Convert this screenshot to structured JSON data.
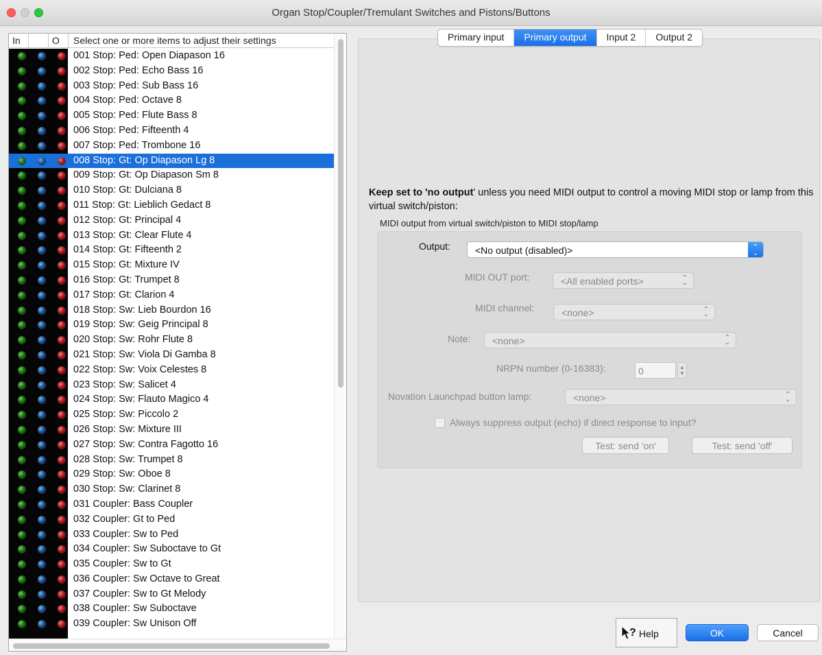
{
  "window": {
    "title": "Organ Stop/Coupler/Tremulant Switches and Pistons/Buttons"
  },
  "list": {
    "header": {
      "in": "In",
      "o": "O",
      "instruction": "Select one or more items to adjust their settings"
    },
    "selected_index": 7,
    "items": [
      "001 Stop: Ped: Open Diapason 16",
      "002 Stop: Ped: Echo Bass 16",
      "003 Stop: Ped: Sub Bass 16",
      "004 Stop: Ped: Octave 8",
      "005 Stop: Ped: Flute Bass 8",
      "006 Stop: Ped: Fifteenth 4",
      "007 Stop: Ped: Trombone 16",
      "008 Stop: Gt: Op Diapason Lg 8",
      "009 Stop: Gt: Op Diapason Sm 8",
      "010 Stop: Gt: Dulciana 8",
      "011 Stop: Gt: Lieblich Gedact 8",
      "012 Stop: Gt: Principal 4",
      "013 Stop: Gt: Clear Flute 4",
      "014 Stop: Gt: Fifteenth 2",
      "015 Stop: Gt: Mixture IV",
      "016 Stop: Gt: Trumpet 8",
      "017 Stop: Gt: Clarion 4",
      "018 Stop: Sw: Lieb Bourdon 16",
      "019 Stop: Sw: Geig Principal 8",
      "020 Stop: Sw: Rohr Flute 8",
      "021 Stop: Sw: Viola Di Gamba 8",
      "022 Stop: Sw: Voix Celestes 8",
      "023 Stop: Sw: Salicet 4",
      "024 Stop: Sw: Flauto Magico 4",
      "025 Stop: Sw: Piccolo 2",
      "026 Stop: Sw: Mixture III",
      "027 Stop: Sw: Contra Fagotto 16",
      "028 Stop: Sw: Trumpet 8",
      "029 Stop: Sw: Oboe 8",
      "030 Stop: Sw: Clarinet 8",
      "031 Coupler: Bass Coupler",
      "032 Coupler: Gt to Ped",
      "033 Coupler: Sw to Ped",
      "034 Coupler: Sw Suboctave to Gt",
      "035 Coupler: Sw to Gt",
      "036 Coupler: Sw Octave to Great",
      "037 Coupler: Sw to Gt Melody",
      "038 Coupler: Sw Suboctave",
      "039 Coupler: Sw Unison Off"
    ]
  },
  "tabs": [
    {
      "label": "Primary input",
      "active": false
    },
    {
      "label": "Primary output",
      "active": true
    },
    {
      "label": "Input 2",
      "active": false
    },
    {
      "label": "Output 2",
      "active": false
    }
  ],
  "output_tab": {
    "info_bold_prefix": "Keep set to '",
    "info_bold_value": "no output",
    "info_rest": "' unless you need MIDI output to control a moving MIDI stop or lamp from this virtual switch/piston:",
    "group_caption": "MIDI output from virtual switch/piston to MIDI stop/lamp",
    "output_label": "Output:",
    "output_value": "<No output (disabled)>",
    "midi_out_port_label": "MIDI OUT port:",
    "midi_out_port_value": "<All enabled ports>",
    "midi_channel_label": "MIDI channel:",
    "midi_channel_value": "<none>",
    "note_label": "Note:",
    "note_value": "<none>",
    "nrpn_label": "NRPN number (0-16383):",
    "nrpn_value": "0",
    "launchpad_label": "Novation Launchpad button lamp:",
    "launchpad_value": "<none>",
    "suppress_label": "Always suppress output (echo) if direct response to input?",
    "suppress_checked": false,
    "test_on_label": "Test: send 'on'",
    "test_off_label": "Test: send 'off'"
  },
  "footer": {
    "help_label": "Help",
    "ok_label": "OK",
    "cancel_label": "Cancel"
  },
  "colors": {
    "accent": "#1a6fe6",
    "selection": "#1a6fd9",
    "led_in": "#1d6a12",
    "led_mid": "#1c4f8a",
    "led_out": "#a01818"
  }
}
